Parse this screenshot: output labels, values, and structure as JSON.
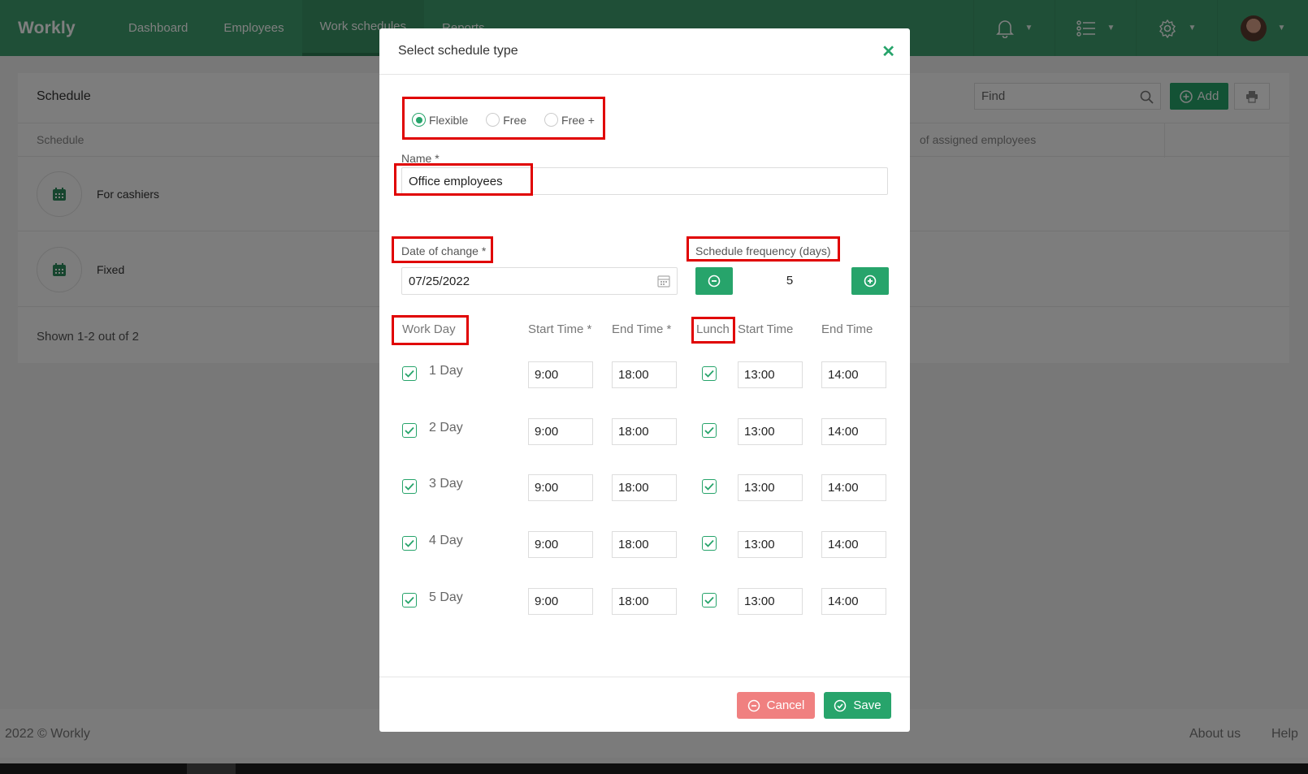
{
  "nav": {
    "logo": "Workly",
    "items": [
      "Dashboard",
      "Employees",
      "Work schedules",
      "Reports"
    ]
  },
  "page": {
    "title": "Schedule",
    "column_schedule": "Schedule",
    "column_assigned": "of assigned employees",
    "rows": [
      "For cashiers",
      "Fixed"
    ],
    "shown": "Shown 1-2 out of 2",
    "search_placeholder": "Find",
    "add_label": "Add"
  },
  "footer": {
    "copyright": "2022 © Workly",
    "about": "About us",
    "help": "Help"
  },
  "modal": {
    "title": "Select schedule type",
    "types": [
      {
        "label": "Flexible",
        "selected": true
      },
      {
        "label": "Free",
        "selected": false
      },
      {
        "label": "Free +",
        "selected": false
      }
    ],
    "name_label": "Name *",
    "name_value": "Office employees",
    "date_label": "Date of change *",
    "date_value": "07/25/2022",
    "freq_label": "Schedule frequency (days)",
    "freq_value": "5",
    "headers": {
      "work_day": "Work Day",
      "start": "Start Time *",
      "end": "End Time *",
      "lunch": "Lunch",
      "lunch_start": "Start Time",
      "lunch_end": "End Time"
    },
    "days": [
      {
        "name": "1 Day",
        "start": "9:00",
        "end": "18:00",
        "lunch_start": "13:00",
        "lunch_end": "14:00"
      },
      {
        "name": "2 Day",
        "start": "9:00",
        "end": "18:00",
        "lunch_start": "13:00",
        "lunch_end": "14:00"
      },
      {
        "name": "3 Day",
        "start": "9:00",
        "end": "18:00",
        "lunch_start": "13:00",
        "lunch_end": "14:00"
      },
      {
        "name": "4 Day",
        "start": "9:00",
        "end": "18:00",
        "lunch_start": "13:00",
        "lunch_end": "14:00"
      },
      {
        "name": "5 Day",
        "start": "9:00",
        "end": "18:00",
        "lunch_start": "13:00",
        "lunch_end": "14:00"
      }
    ],
    "cancel": "Cancel",
    "save": "Save"
  },
  "colors": {
    "brand": "#3f9f6f",
    "accent": "#27a46b",
    "cancel": "#f08080",
    "highlight": "#e00000"
  }
}
